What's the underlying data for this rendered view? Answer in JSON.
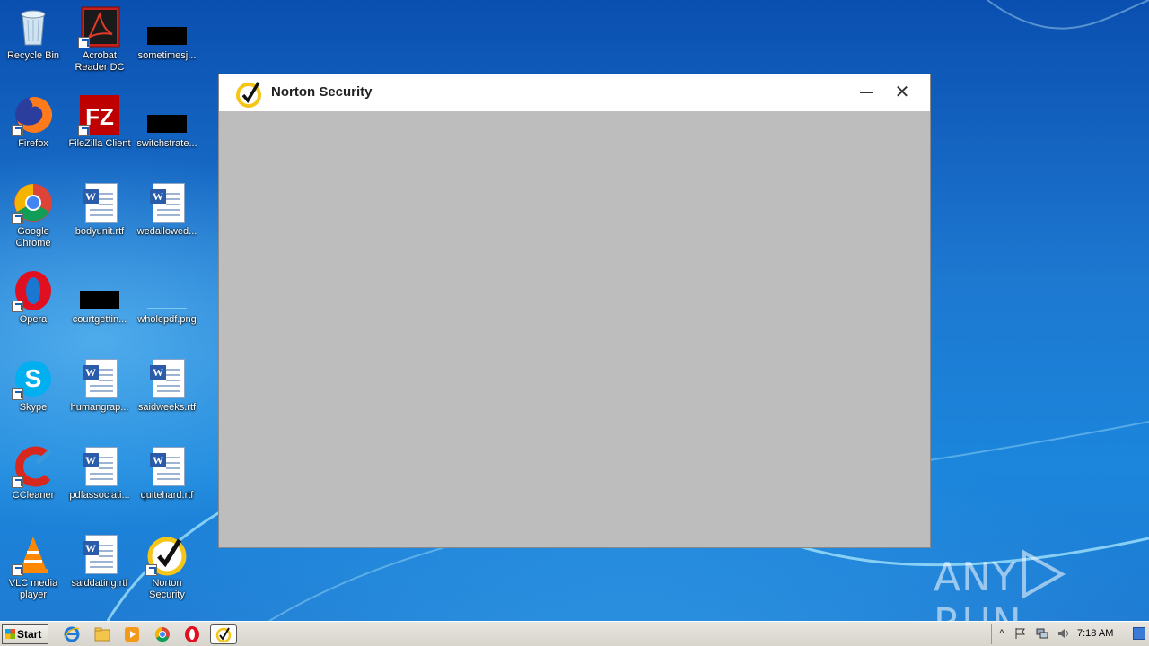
{
  "desktop": {
    "icons": [
      {
        "label": "Recycle Bin"
      },
      {
        "label": "Acrobat Reader DC"
      },
      {
        "label": "sometimesj..."
      },
      {
        "label": "Firefox"
      },
      {
        "label": "FileZilla Client"
      },
      {
        "label": "switchstrate..."
      },
      {
        "label": "Google Chrome"
      },
      {
        "label": "bodyunit.rtf"
      },
      {
        "label": "wedallowed..."
      },
      {
        "label": "Opera"
      },
      {
        "label": "courtgettin..."
      },
      {
        "label": "wholepdf.png"
      },
      {
        "label": "Skype"
      },
      {
        "label": "humangrap..."
      },
      {
        "label": "saidweeks.rtf"
      },
      {
        "label": "CCleaner"
      },
      {
        "label": "pdfassociati..."
      },
      {
        "label": "quitehard.rtf"
      },
      {
        "label": "VLC media player"
      },
      {
        "label": "saiddating.rtf"
      },
      {
        "label": "Norton Security"
      }
    ]
  },
  "window": {
    "title": "Norton Security",
    "minimize_icon": "minimize-icon",
    "close_glyph": "✕"
  },
  "watermark": {
    "text_left": "ANY",
    "text_right": "RUN"
  },
  "taskbar": {
    "start_label": "Start",
    "clock": "7:18 AM",
    "tray_expand": "^"
  },
  "colors": {
    "norton_yellow": "#f5c518",
    "window_body": "#bdbdbd",
    "desktop_blue": "#1674c8"
  }
}
